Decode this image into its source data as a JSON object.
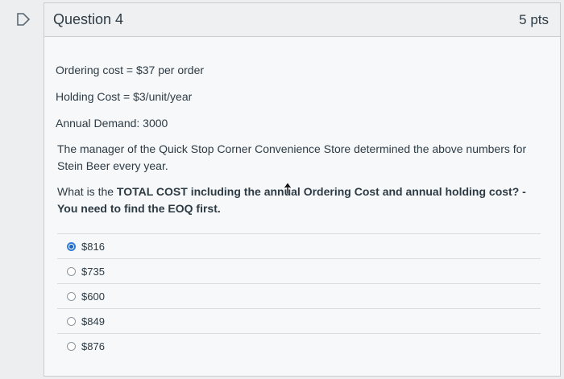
{
  "question": {
    "title": "Question 4",
    "points": "5 pts"
  },
  "facts": {
    "ordering_cost": "Ordering cost = $37 per order",
    "holding_cost": "Holding Cost = $3/unit/year",
    "annual_demand": "Annual Demand: 3000"
  },
  "context": "The manager of the Quick Stop Corner Convenience Store determined the above numbers for Stein Beer every year.",
  "prompt": {
    "part1": "What is the ",
    "bold": "TOTAL COST including the annual Ordering Cost and annual holding cost? - You need to find the EOQ first."
  },
  "answers": [
    {
      "label": "$816",
      "selected": true
    },
    {
      "label": "$735",
      "selected": false
    },
    {
      "label": "$600",
      "selected": false
    },
    {
      "label": "$849",
      "selected": false
    },
    {
      "label": "$876",
      "selected": false
    }
  ]
}
